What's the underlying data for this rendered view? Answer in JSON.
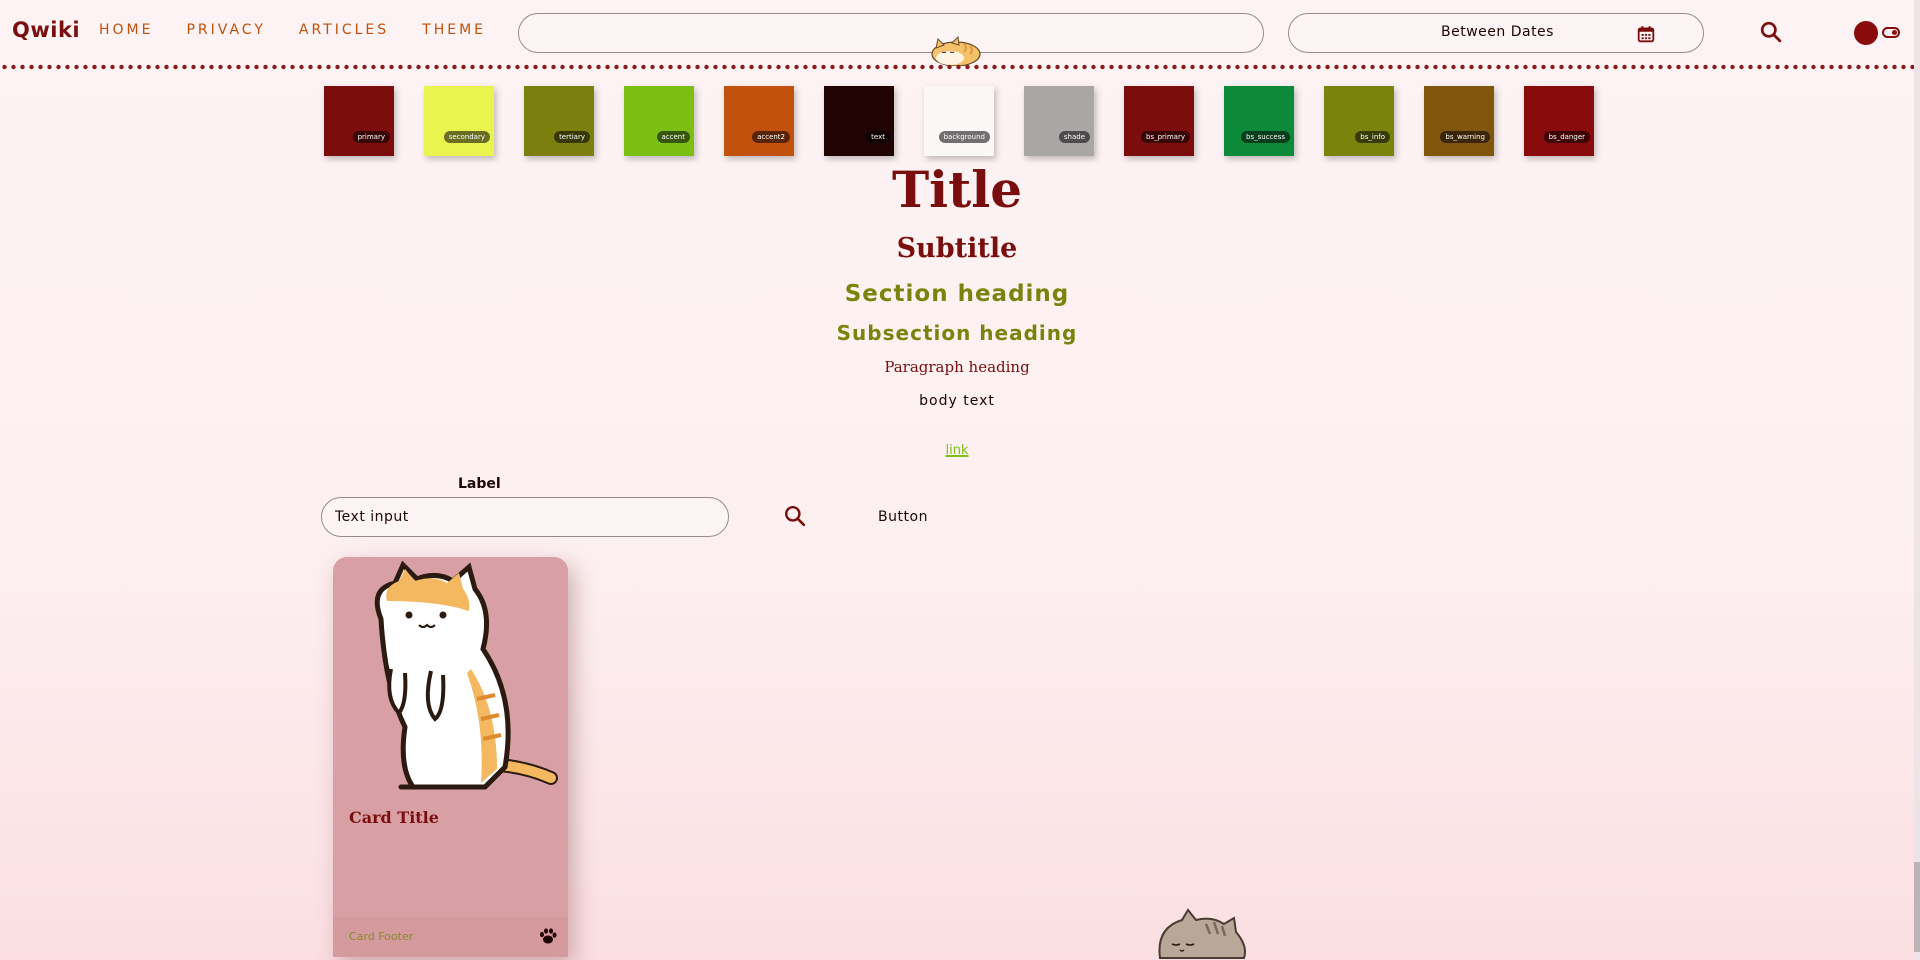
{
  "header": {
    "logo": "Qwiki",
    "nav": [
      "HOME",
      "PRIVACY",
      "ARTICLES",
      "THEME"
    ],
    "search_value": "",
    "date_label": "Between Dates"
  },
  "swatches": [
    {
      "label": "primary",
      "color": "#7c0d0d"
    },
    {
      "label": "secondary",
      "color": "#e9f44e"
    },
    {
      "label": "tertiary",
      "color": "#7a7f0d"
    },
    {
      "label": "accent",
      "color": "#7bbf12"
    },
    {
      "label": "accent2",
      "color": "#c1510c"
    },
    {
      "label": "text",
      "color": "#200404"
    },
    {
      "label": "background",
      "color": "#fbf7f7"
    },
    {
      "label": "shade",
      "color": "#aaa6a6"
    },
    {
      "label": "bs_primary",
      "color": "#7c0d0d"
    },
    {
      "label": "bs_success",
      "color": "#0c8a3a"
    },
    {
      "label": "bs_info",
      "color": "#7a840c"
    },
    {
      "label": "bs_warning",
      "color": "#80560c"
    },
    {
      "label": "bs_danger",
      "color": "#8a0b0b"
    }
  ],
  "typography": {
    "title": "Title",
    "subtitle": "Subtitle",
    "section_heading": "Section heading",
    "subsection_heading": "Subsection heading",
    "paragraph_heading": "Paragraph heading",
    "body_text": "body text",
    "link": "link"
  },
  "form": {
    "label": "Label",
    "input_value": "Text input",
    "button_label": "Button"
  },
  "card": {
    "title": "Card Title",
    "footer": "Card Footer"
  },
  "icons": {
    "date": "calendar-icon",
    "search": "search-icon",
    "toggle": "theme-toggle",
    "footer": "paw-icon"
  }
}
